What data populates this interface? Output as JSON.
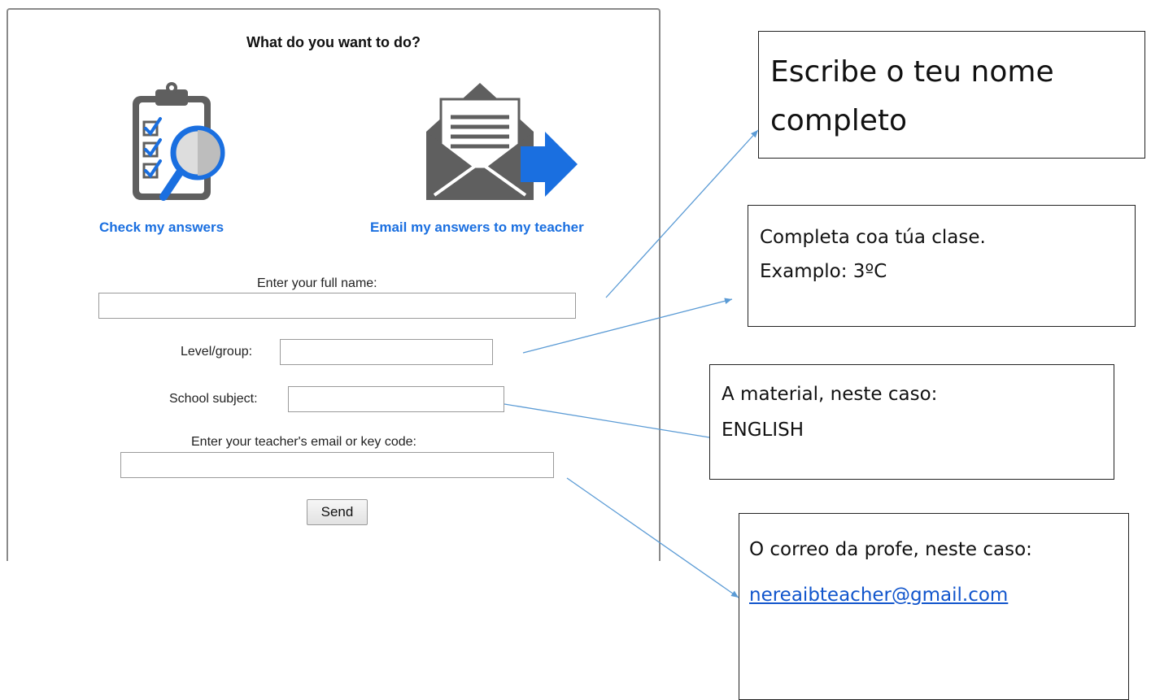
{
  "dialog": {
    "title": "What do you want to do?",
    "options": [
      {
        "label": "Check my answers",
        "icon": "clipboard-magnifier-icon"
      },
      {
        "label": "Email my answers to my teacher",
        "icon": "envelope-arrow-icon"
      }
    ],
    "fields": {
      "full_name": {
        "label": "Enter your full name:",
        "value": ""
      },
      "level_group": {
        "label": "Level/group:",
        "value": ""
      },
      "school_subject": {
        "label": "School subject:",
        "value": ""
      },
      "teacher_email": {
        "label": "Enter your teacher's email or key code:",
        "value": ""
      }
    },
    "send_label": "Send"
  },
  "annotations": {
    "name": {
      "line1": "Escribe o teu nome",
      "line2": "completo"
    },
    "group": {
      "line1": "Completa coa túa clase.",
      "line2": "Examplo: 3ºC"
    },
    "subject": {
      "line1": "A material, neste caso:",
      "line2": "ENGLISH"
    },
    "email": {
      "line1": "O correo da profe, neste caso:",
      "link": "nereaibteacher@gmail.com"
    }
  },
  "colors": {
    "link_blue": "#1a6fe0",
    "icon_gray": "#5f5f5f",
    "arrow_blue": "#5b9bd5"
  }
}
